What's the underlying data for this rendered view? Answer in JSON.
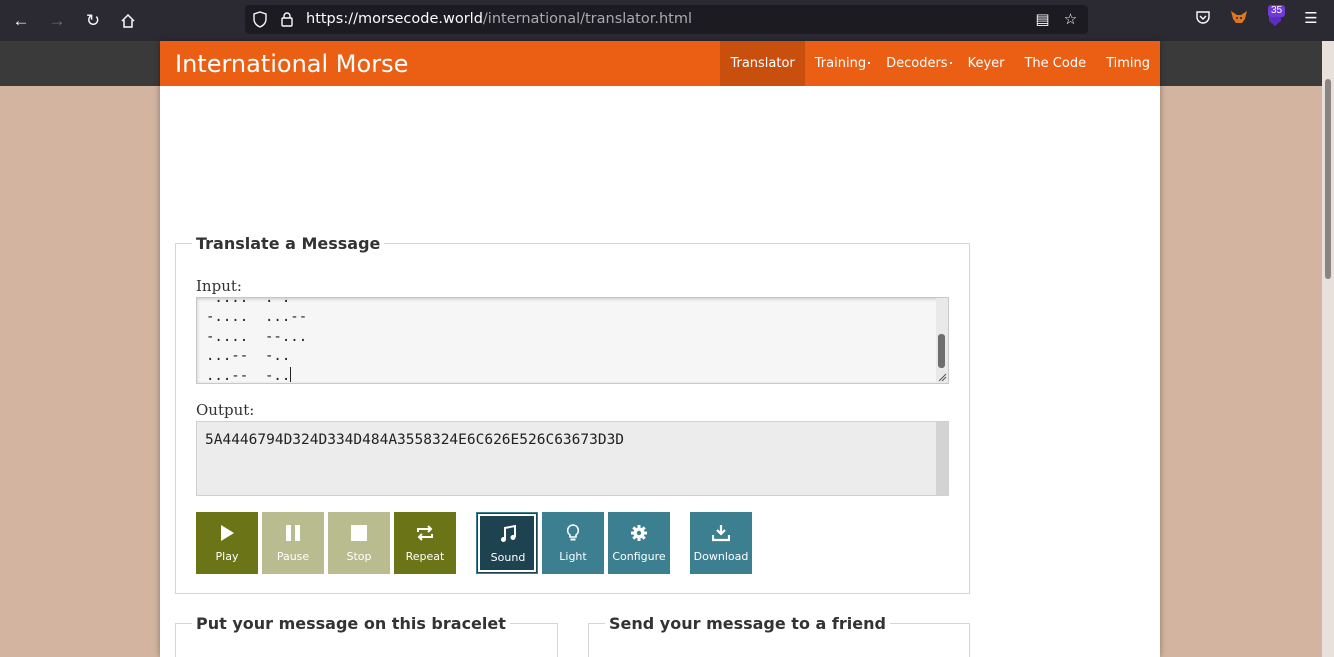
{
  "browser": {
    "url_host": "https://morsecode.world",
    "url_path": "/international/translator.html",
    "extension_badge": "35"
  },
  "site": {
    "title": "International Morse",
    "nav": [
      {
        "label": "Translator",
        "active": true
      },
      {
        "label": "Training",
        "has_submenu": true
      },
      {
        "label": "Decoders",
        "has_submenu": true
      },
      {
        "label": "Keyer"
      },
      {
        "label": "The Code"
      },
      {
        "label": "Timing"
      }
    ]
  },
  "translator": {
    "legend": "Translate a Message",
    "input_label": "Input:",
    "input_lines": [
      " ....  . .",
      "-....  ...--",
      "-....  --...",
      "...--  -..",
      "...--  -.."
    ],
    "output_label": "Output:",
    "output_value": "5A4446794D324D334D484A3558324E6C626E526C63673D3D",
    "buttons": [
      {
        "label": "Play",
        "icon": "play-icon",
        "style": "olive"
      },
      {
        "label": "Pause",
        "icon": "pause-icon",
        "style": "olive-dim"
      },
      {
        "label": "Stop",
        "icon": "stop-icon",
        "style": "olive-dim"
      },
      {
        "label": "Repeat",
        "icon": "repeat-icon",
        "style": "olive"
      },
      {
        "label": "Sound",
        "icon": "music-note-icon",
        "style": "dark-teal"
      },
      {
        "label": "Light",
        "icon": "lightbulb-icon",
        "style": "teal"
      },
      {
        "label": "Configure",
        "icon": "gear-icon",
        "style": "teal"
      },
      {
        "label": "Download",
        "icon": "download-icon",
        "style": "teal"
      }
    ]
  },
  "bracelet": {
    "legend": "Put your message on this bracelet"
  },
  "friend": {
    "legend": "Send your message to a friend"
  },
  "colors": {
    "header_orange": "#ea5f14",
    "active_nav": "#c94f0e",
    "olive": "#6b7518",
    "teal": "#3c7f91",
    "page_bg": "#d2b4a0"
  }
}
